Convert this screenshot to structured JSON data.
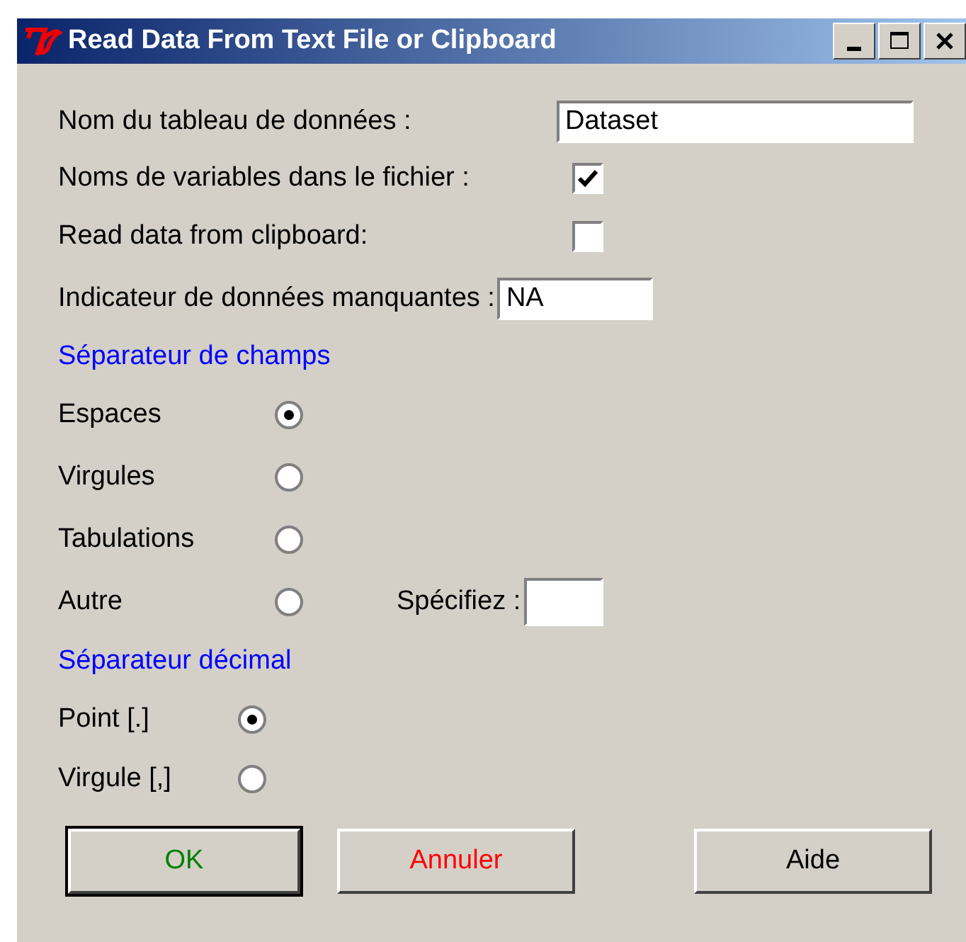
{
  "window": {
    "title": "Read Data From Text File or Clipboard"
  },
  "name_field": {
    "label": "Nom du tableau de données :",
    "value": "Dataset"
  },
  "variables_in_file": {
    "label": "Noms de variables dans le fichier :",
    "checked": true
  },
  "from_clipboard": {
    "label": "Read data from clipboard:",
    "checked": false
  },
  "missing_field": {
    "label": "Indicateur de données manquantes :",
    "value": "NA"
  },
  "field_separator": {
    "heading": "Séparateur de champs",
    "options": [
      {
        "label": "Espaces",
        "selected": true
      },
      {
        "label": "Virgules",
        "selected": false
      },
      {
        "label": "Tabulations",
        "selected": false
      },
      {
        "label": "Autre",
        "selected": false
      }
    ],
    "specify_label": "Spécifiez :"
  },
  "decimal_separator": {
    "heading": "Séparateur décimal",
    "options": [
      {
        "label": "Point [.]",
        "selected": true
      },
      {
        "label": "Virgule [,]",
        "selected": false
      }
    ]
  },
  "buttons": [
    {
      "label": "OK",
      "color": "#008000",
      "default": true
    },
    {
      "label": "Annuler",
      "color": "#ff0000",
      "default": false
    },
    {
      "label": "Aide",
      "color": "#000000",
      "default": false
    }
  ]
}
